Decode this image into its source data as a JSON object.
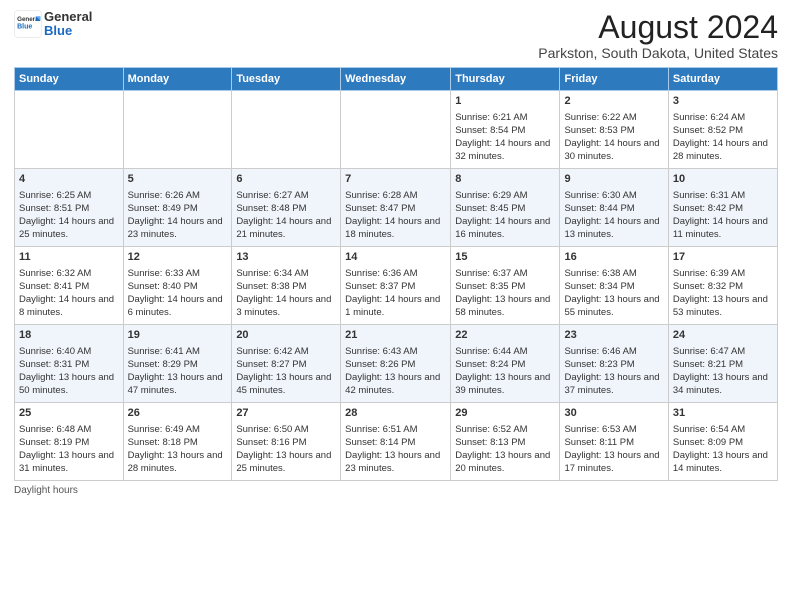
{
  "header": {
    "logo_general": "General",
    "logo_blue": "Blue",
    "main_title": "August 2024",
    "subtitle": "Parkston, South Dakota, United States"
  },
  "days_of_week": [
    "Sunday",
    "Monday",
    "Tuesday",
    "Wednesday",
    "Thursday",
    "Friday",
    "Saturday"
  ],
  "weeks": [
    [
      {
        "day": "",
        "info": ""
      },
      {
        "day": "",
        "info": ""
      },
      {
        "day": "",
        "info": ""
      },
      {
        "day": "",
        "info": ""
      },
      {
        "day": "1",
        "info": "Sunrise: 6:21 AM\nSunset: 8:54 PM\nDaylight: 14 hours and 32 minutes."
      },
      {
        "day": "2",
        "info": "Sunrise: 6:22 AM\nSunset: 8:53 PM\nDaylight: 14 hours and 30 minutes."
      },
      {
        "day": "3",
        "info": "Sunrise: 6:24 AM\nSunset: 8:52 PM\nDaylight: 14 hours and 28 minutes."
      }
    ],
    [
      {
        "day": "4",
        "info": "Sunrise: 6:25 AM\nSunset: 8:51 PM\nDaylight: 14 hours and 25 minutes."
      },
      {
        "day": "5",
        "info": "Sunrise: 6:26 AM\nSunset: 8:49 PM\nDaylight: 14 hours and 23 minutes."
      },
      {
        "day": "6",
        "info": "Sunrise: 6:27 AM\nSunset: 8:48 PM\nDaylight: 14 hours and 21 minutes."
      },
      {
        "day": "7",
        "info": "Sunrise: 6:28 AM\nSunset: 8:47 PM\nDaylight: 14 hours and 18 minutes."
      },
      {
        "day": "8",
        "info": "Sunrise: 6:29 AM\nSunset: 8:45 PM\nDaylight: 14 hours and 16 minutes."
      },
      {
        "day": "9",
        "info": "Sunrise: 6:30 AM\nSunset: 8:44 PM\nDaylight: 14 hours and 13 minutes."
      },
      {
        "day": "10",
        "info": "Sunrise: 6:31 AM\nSunset: 8:42 PM\nDaylight: 14 hours and 11 minutes."
      }
    ],
    [
      {
        "day": "11",
        "info": "Sunrise: 6:32 AM\nSunset: 8:41 PM\nDaylight: 14 hours and 8 minutes."
      },
      {
        "day": "12",
        "info": "Sunrise: 6:33 AM\nSunset: 8:40 PM\nDaylight: 14 hours and 6 minutes."
      },
      {
        "day": "13",
        "info": "Sunrise: 6:34 AM\nSunset: 8:38 PM\nDaylight: 14 hours and 3 minutes."
      },
      {
        "day": "14",
        "info": "Sunrise: 6:36 AM\nSunset: 8:37 PM\nDaylight: 14 hours and 1 minute."
      },
      {
        "day": "15",
        "info": "Sunrise: 6:37 AM\nSunset: 8:35 PM\nDaylight: 13 hours and 58 minutes."
      },
      {
        "day": "16",
        "info": "Sunrise: 6:38 AM\nSunset: 8:34 PM\nDaylight: 13 hours and 55 minutes."
      },
      {
        "day": "17",
        "info": "Sunrise: 6:39 AM\nSunset: 8:32 PM\nDaylight: 13 hours and 53 minutes."
      }
    ],
    [
      {
        "day": "18",
        "info": "Sunrise: 6:40 AM\nSunset: 8:31 PM\nDaylight: 13 hours and 50 minutes."
      },
      {
        "day": "19",
        "info": "Sunrise: 6:41 AM\nSunset: 8:29 PM\nDaylight: 13 hours and 47 minutes."
      },
      {
        "day": "20",
        "info": "Sunrise: 6:42 AM\nSunset: 8:27 PM\nDaylight: 13 hours and 45 minutes."
      },
      {
        "day": "21",
        "info": "Sunrise: 6:43 AM\nSunset: 8:26 PM\nDaylight: 13 hours and 42 minutes."
      },
      {
        "day": "22",
        "info": "Sunrise: 6:44 AM\nSunset: 8:24 PM\nDaylight: 13 hours and 39 minutes."
      },
      {
        "day": "23",
        "info": "Sunrise: 6:46 AM\nSunset: 8:23 PM\nDaylight: 13 hours and 37 minutes."
      },
      {
        "day": "24",
        "info": "Sunrise: 6:47 AM\nSunset: 8:21 PM\nDaylight: 13 hours and 34 minutes."
      }
    ],
    [
      {
        "day": "25",
        "info": "Sunrise: 6:48 AM\nSunset: 8:19 PM\nDaylight: 13 hours and 31 minutes."
      },
      {
        "day": "26",
        "info": "Sunrise: 6:49 AM\nSunset: 8:18 PM\nDaylight: 13 hours and 28 minutes."
      },
      {
        "day": "27",
        "info": "Sunrise: 6:50 AM\nSunset: 8:16 PM\nDaylight: 13 hours and 25 minutes."
      },
      {
        "day": "28",
        "info": "Sunrise: 6:51 AM\nSunset: 8:14 PM\nDaylight: 13 hours and 23 minutes."
      },
      {
        "day": "29",
        "info": "Sunrise: 6:52 AM\nSunset: 8:13 PM\nDaylight: 13 hours and 20 minutes."
      },
      {
        "day": "30",
        "info": "Sunrise: 6:53 AM\nSunset: 8:11 PM\nDaylight: 13 hours and 17 minutes."
      },
      {
        "day": "31",
        "info": "Sunrise: 6:54 AM\nSunset: 8:09 PM\nDaylight: 13 hours and 14 minutes."
      }
    ]
  ],
  "footer": {
    "note": "Daylight hours"
  }
}
